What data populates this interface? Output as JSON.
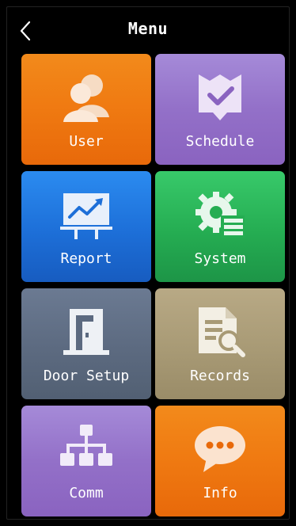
{
  "header": {
    "title": "Menu",
    "back_icon": "chevron-left-icon"
  },
  "tiles": [
    {
      "label": "User",
      "icon": "users-icon",
      "color": "#f07b12"
    },
    {
      "label": "Schedule",
      "icon": "calendar-check-icon",
      "color": "#9370c8"
    },
    {
      "label": "Report",
      "icon": "chart-board-icon",
      "color": "#1d6fd8"
    },
    {
      "label": "System",
      "icon": "gear-list-icon",
      "color": "#25ad52"
    },
    {
      "label": "Door Setup",
      "icon": "door-icon",
      "color": "#5c6a80"
    },
    {
      "label": "Records",
      "icon": "document-search-icon",
      "color": "#a89a75"
    },
    {
      "label": "Comm",
      "icon": "network-icon",
      "color": "#9370c8"
    },
    {
      "label": "Info",
      "icon": "chat-bubble-icon",
      "color": "#f07b12"
    }
  ]
}
